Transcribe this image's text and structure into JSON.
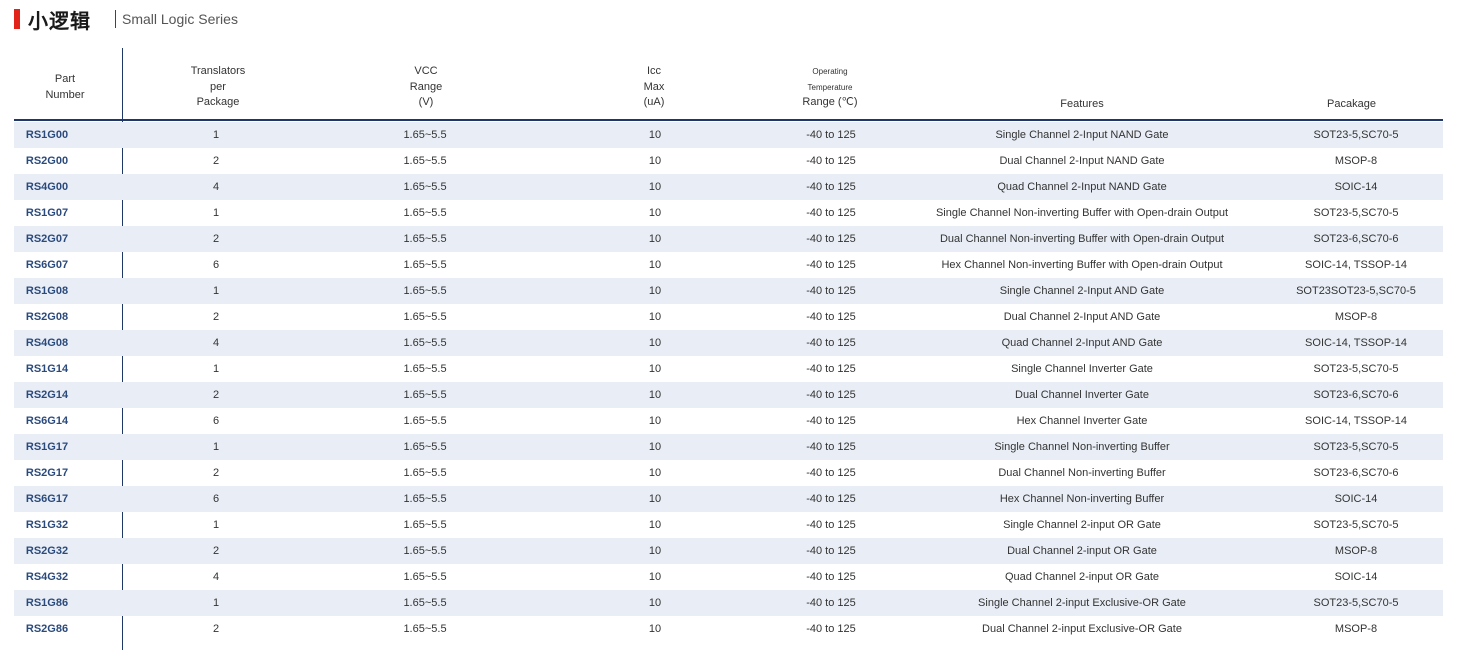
{
  "title": {
    "cn": "小逻辑",
    "en": "Small Logic Series"
  },
  "headers": {
    "part": [
      "Part",
      "Number"
    ],
    "translators": [
      "Translators",
      "per",
      "Package"
    ],
    "vcc": [
      "VCC",
      "Range",
      "(V)"
    ],
    "icc": [
      "Icc",
      "Max",
      "(uA)"
    ],
    "temp": [
      "Operating",
      "Temperature",
      "Range (℃)"
    ],
    "features": "Features",
    "package": "Pacakage"
  },
  "rows": [
    {
      "part": "RS1G00",
      "trans": "1",
      "vcc": "1.65~5.5",
      "icc": "10",
      "temp": "-40 to 125",
      "feat": "Single Channel 2-Input NAND Gate",
      "pkg": "SOT23-5,SC70-5"
    },
    {
      "part": "RS2G00",
      "trans": "2",
      "vcc": "1.65~5.5",
      "icc": "10",
      "temp": "-40 to 125",
      "feat": "Dual Channel 2-Input NAND Gate",
      "pkg": "MSOP-8"
    },
    {
      "part": "RS4G00",
      "trans": "4",
      "vcc": "1.65~5.5",
      "icc": "10",
      "temp": "-40 to 125",
      "feat": "Quad Channel 2-Input NAND Gate",
      "pkg": "SOIC-14"
    },
    {
      "part": "RS1G07",
      "trans": "1",
      "vcc": "1.65~5.5",
      "icc": "10",
      "temp": "-40 to 125",
      "feat": "Single Channel Non-inverting Buffer with Open-drain Output",
      "pkg": "SOT23-5,SC70-5"
    },
    {
      "part": "RS2G07",
      "trans": "2",
      "vcc": "1.65~5.5",
      "icc": "10",
      "temp": "-40 to 125",
      "feat": "Dual Channel Non-inverting Buffer with Open-drain Output",
      "pkg": "SOT23-6,SC70-6"
    },
    {
      "part": "RS6G07",
      "trans": "6",
      "vcc": "1.65~5.5",
      "icc": "10",
      "temp": "-40 to 125",
      "feat": "Hex Channel Non-inverting Buffer with Open-drain Output",
      "pkg": "SOIC-14, TSSOP-14"
    },
    {
      "part": "RS1G08",
      "trans": "1",
      "vcc": "1.65~5.5",
      "icc": "10",
      "temp": "-40 to 125",
      "feat": "Single Channel 2-Input AND Gate",
      "pkg": "SOT23SOT23-5,SC70-5"
    },
    {
      "part": "RS2G08",
      "trans": "2",
      "vcc": "1.65~5.5",
      "icc": "10",
      "temp": "-40 to 125",
      "feat": "Dual Channel 2-Input AND Gate",
      "pkg": "MSOP-8"
    },
    {
      "part": "RS4G08",
      "trans": "4",
      "vcc": "1.65~5.5",
      "icc": "10",
      "temp": "-40 to 125",
      "feat": "Quad Channel 2-Input AND Gate",
      "pkg": "SOIC-14, TSSOP-14"
    },
    {
      "part": "RS1G14",
      "trans": "1",
      "vcc": "1.65~5.5",
      "icc": "10",
      "temp": "-40 to 125",
      "feat": "Single Channel Inverter Gate",
      "pkg": "SOT23-5,SC70-5"
    },
    {
      "part": "RS2G14",
      "trans": "2",
      "vcc": "1.65~5.5",
      "icc": "10",
      "temp": "-40 to 125",
      "feat": "Dual Channel Inverter Gate",
      "pkg": "SOT23-6,SC70-6"
    },
    {
      "part": "RS6G14",
      "trans": "6",
      "vcc": "1.65~5.5",
      "icc": "10",
      "temp": "-40 to 125",
      "feat": "Hex Channel Inverter Gate",
      "pkg": "SOIC-14, TSSOP-14"
    },
    {
      "part": "RS1G17",
      "trans": "1",
      "vcc": "1.65~5.5",
      "icc": "10",
      "temp": "-40 to 125",
      "feat": "Single Channel Non-inverting Buffer",
      "pkg": "SOT23-5,SC70-5"
    },
    {
      "part": "RS2G17",
      "trans": "2",
      "vcc": "1.65~5.5",
      "icc": "10",
      "temp": "-40 to 125",
      "feat": "Dual Channel Non-inverting Buffer",
      "pkg": "SOT23-6,SC70-6"
    },
    {
      "part": "RS6G17",
      "trans": "6",
      "vcc": "1.65~5.5",
      "icc": "10",
      "temp": "-40 to 125",
      "feat": "Hex Channel Non-inverting Buffer",
      "pkg": "SOIC-14"
    },
    {
      "part": "RS1G32",
      "trans": "1",
      "vcc": "1.65~5.5",
      "icc": "10",
      "temp": "-40 to 125",
      "feat": "Single Channel 2-input OR Gate",
      "pkg": "SOT23-5,SC70-5"
    },
    {
      "part": "RS2G32",
      "trans": "2",
      "vcc": "1.65~5.5",
      "icc": "10",
      "temp": "-40 to 125",
      "feat": "Dual Channel 2-input OR Gate",
      "pkg": "MSOP-8"
    },
    {
      "part": "RS4G32",
      "trans": "4",
      "vcc": "1.65~5.5",
      "icc": "10",
      "temp": "-40 to 125",
      "feat": "Quad Channel 2-input OR Gate",
      "pkg": "SOIC-14"
    },
    {
      "part": "RS1G86",
      "trans": "1",
      "vcc": "1.65~5.5",
      "icc": "10",
      "temp": "-40 to 125",
      "feat": "Single Channel 2-input Exclusive-OR Gate",
      "pkg": "SOT23-5,SC70-5"
    },
    {
      "part": "RS2G86",
      "trans": "2",
      "vcc": "1.65~5.5",
      "icc": "10",
      "temp": "-40 to 125",
      "feat": "Dual Channel 2-input Exclusive-OR Gate",
      "pkg": "MSOP-8"
    }
  ],
  "colors": {
    "accent_red": "#e2231a",
    "rule_navy": "#1f3868",
    "row_shade": "#e9eef6",
    "part_text": "#2b4a7c"
  }
}
